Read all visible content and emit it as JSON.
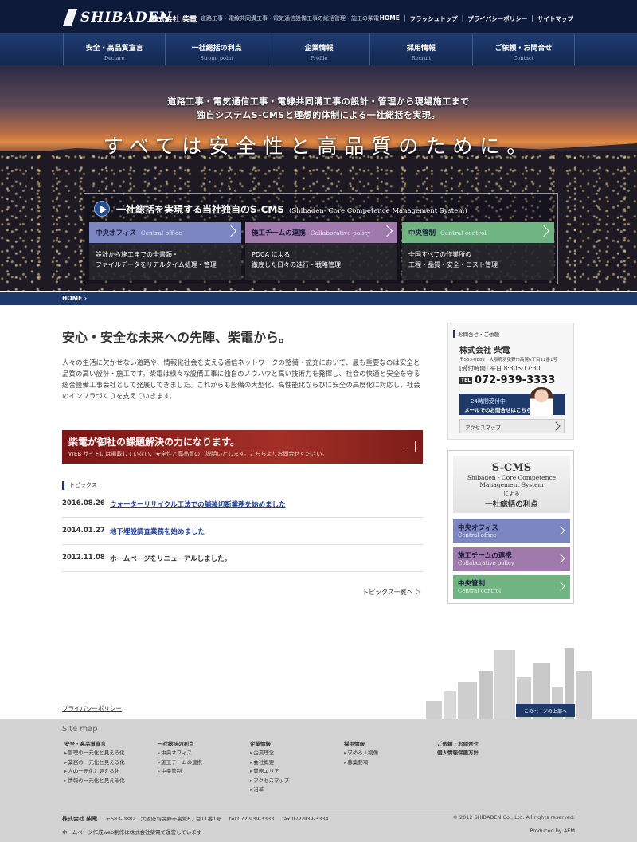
{
  "header": {
    "logo_text": "SHIBADEN",
    "company_name": "株式会社 柴電",
    "tagline": "道路工事・電線共同溝工事・電気通信設備工事の総括管理・施工の柴電",
    "util_links": [
      "HOME",
      "フラッシュトップ",
      "プライバシーポリシー",
      "サイトマップ"
    ],
    "util_sep": "|"
  },
  "nav": [
    {
      "jp": "安全・高品質宣言",
      "en": "Declare"
    },
    {
      "jp": "一社総括の利点",
      "en": "Strong point"
    },
    {
      "jp": "企業情報",
      "en": "Profile"
    },
    {
      "jp": "採用情報",
      "en": "Recruit"
    },
    {
      "jp": "ご依頼・お問合せ",
      "en": "Contact"
    }
  ],
  "hero": {
    "line1": "道路工事・電気通信工事・電線共同溝工事の設計・管理から現場施工まで",
    "line2": "独自システムS-CMSと理想的体制による一社総括を実現。",
    "main": "すべては安全性と高品質のために。",
    "cms_title": "一社総括を実現する当社独自のS-CMS",
    "cms_sub": "(Shibaden- Core Competence Management System)",
    "cards": [
      {
        "jp": "中央オフィス",
        "en": "Central office",
        "body1": "設計から施工までの全書類・",
        "body2": "ファイルデータをリアルタイム処理・管理"
      },
      {
        "jp": "施工チームの連携",
        "en": "Collaborative policy",
        "body1": "PDCA による",
        "body2": "徹底した日々の進行・戦略管理"
      },
      {
        "jp": "中央管制",
        "en": "Central control",
        "body1": "全国すべての作業所の",
        "body2": "工程・品質・安全・コスト管理"
      }
    ]
  },
  "breadcrumb": "HOME ›",
  "main": {
    "heading": "安心・安全な未来への先陣、柴電から。",
    "intro": "人々の生活に欠かせない道路や、情報化社会を支える通信ネットワークの整備・拡充において、最も重要なのは安全と品質の高い設計・施工です。柴電は様々な設備工事に独自のノウハウと高い技術力を発揮し、社会の快適と安全を守る総合設備工事会社として発展してきました。これからも設備の大型化、高性能化ならびに安全の高度化に対応し、社会のインフラづくりを支えていきます。",
    "banner_title": "柴電が御社の課題解決の力になります。",
    "banner_sub": "WEB サイトには掲載していない、安全性と高品質のご説明いたします。こちらよりお問合せください。",
    "topics_label": "トピックス",
    "topics": [
      {
        "date": "2016.08.26",
        "text": "ウォーターリサイクル工法での舗装切断業務を始めました"
      },
      {
        "date": "2014.01.27",
        "text": "地下埋設調査業務を始めました"
      },
      {
        "date": "2012.11.08",
        "text": "ホームページをリニューアルしました。"
      }
    ],
    "topics_more": "トピックス一覧へ ＞"
  },
  "sidebar": {
    "contact_label": "お問合せ・ご依頼",
    "name": "株式会社 柴電",
    "address": "〒583-0882　大阪府羽曳野市高鷲6丁目11番1号",
    "hours": "[受付時間] 平日 8:30〜17:30",
    "tel_tag": "TEL",
    "tel": "072-939-3333",
    "mail1": "24時間受付中",
    "mail2": "メールでのお問合せはこちら",
    "access": "アクセスマップ",
    "cms_title": "S-CMS",
    "cms_sub1": "Shibaden - Core Competence",
    "cms_sub2": "Management System",
    "cms_yoru": "による",
    "cms_rieki": "一社総括の利点",
    "buttons": [
      {
        "jp": "中央オフィス",
        "en": "Central office"
      },
      {
        "jp": "施工チームの連携",
        "en": "Collaborative policy"
      },
      {
        "jp": "中央管制",
        "en": "Central control"
      }
    ]
  },
  "pagetop": "このページの上部へ",
  "privacy": "プライバシーポリシー",
  "footer": {
    "sitemap_title": "Site map",
    "cols": [
      {
        "head": "安全・高品質宣言",
        "items": [
          "管理の一元化と見える化",
          "業務の一元化と見える化",
          "人の一元化と見える化",
          "情報の一元化と見える化"
        ]
      },
      {
        "head": "一社総括の利点",
        "items": [
          "中央オフィス",
          "施工チームの連携",
          "中央管制"
        ]
      },
      {
        "head": "企業情報",
        "items": [
          "企業理念",
          "会社概要",
          "業務エリア",
          "アクセスマップ",
          "沿革"
        ]
      },
      {
        "head": "採用情報",
        "items": [
          "求める人物像",
          "募集要項"
        ]
      },
      {
        "head": "ご依頼・お問合せ",
        "head2": "個人情報保護方針",
        "items": []
      }
    ],
    "info_name": "株式会社 柴電",
    "info_addr": "〒583-0882　大阪府羽曳野市高鷲6丁目11番1号",
    "info_tel": "tel 072-939-3333",
    "info_fax": "fax 072-939-3334",
    "copyright": "© 2012 SHIBADEN Co., Ltd. All rights reserved.",
    "bottom": "ホームページ作成web制作は株式会社柴電で運営しています",
    "produced": "Produced by AEM"
  },
  "colors": {
    "navy": "#0e1a3a",
    "blue_card": "#7c86c0",
    "purple_card": "#a079ad",
    "green_card": "#6fb481",
    "banner_red": "#8f2420"
  }
}
